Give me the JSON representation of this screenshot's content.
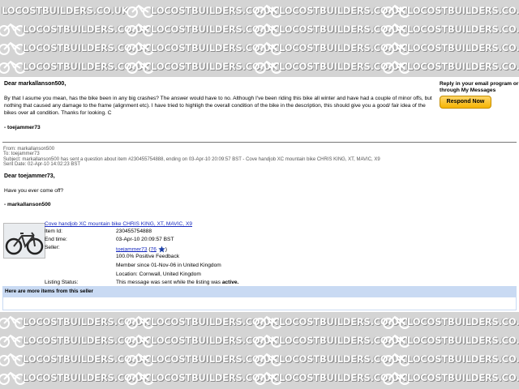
{
  "watermark": {
    "text": "LOCOSTBUILDERS.CO.UK"
  },
  "message1": {
    "salutation": "Dear markallanson500,",
    "body": "By that I asume you mean, has the bike been in any big crashes? The answer would have to no. Although I've been riding this bike all winter and have had a couple of minor offs, but nothing that caused any damage to the frame (alignment etc). I have tried to highligh the overall condition of the bike in the description, this should give you a good/ fair idea of the bikes over all condition. Thanks for looking. C",
    "signature": "- toejammer73"
  },
  "reply": {
    "text": "Reply in your email program or through My Messages",
    "button_label": "Respond Now"
  },
  "meta": {
    "from": "From: markallanson500",
    "to": "To: toejammer73",
    "subject": "Subject: markallanson500 has sent a question about item #230455754888, ending on 03-Apr-10 20:09:57 BST - Cove handjob XC mountain bike CHRIS KING, XT, MAVIC, X9",
    "sent": "Sent Date: 02-Apr-10 14:02:23 BST"
  },
  "message2": {
    "salutation": "Dear toejammer73,",
    "question": "Have you ever come off?",
    "signature": "- markallanson500"
  },
  "item": {
    "title": "Cove handjob XC mountain bike CHRIS KING, XT, MAVIC, X9",
    "item_id_label": "Item Id:",
    "item_id": "230455754888",
    "end_time_label": "End time:",
    "end_time": "03-Apr-10 20:09:57 BST",
    "seller_label": "Seller:",
    "seller_name": "toejammer73",
    "seller_open": "(",
    "seller_score": "76",
    "seller_close": ")",
    "feedback": "100.0% Positive Feedback",
    "member_since": "Member since 01-Nov-06 in United Kingdom",
    "location": "Location: Cornwall, United Kingdom",
    "status_label": "Listing Status:",
    "status_text": "This message was sent while the listing was",
    "status_value": "active."
  },
  "more_items": {
    "header": "Here are more items from this seller"
  },
  "colors": {
    "link": "#1a2cc0",
    "band": "#c9daf3",
    "button": "#f5b400"
  }
}
